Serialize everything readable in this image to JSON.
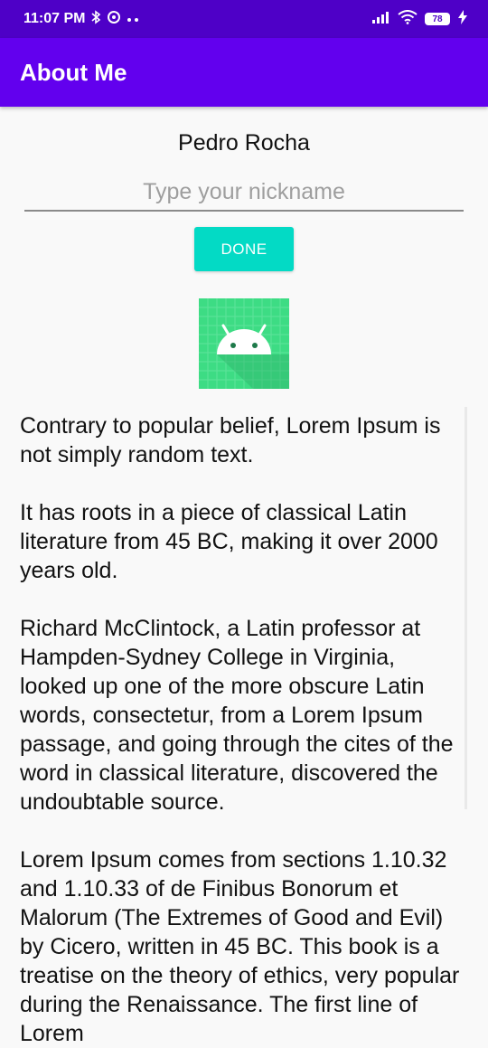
{
  "status_bar": {
    "time": "11:07 PM",
    "icons": [
      "bluetooth-icon",
      "hotspot-icon",
      "more-dots-icon",
      "signal-icon",
      "wifi-icon",
      "battery-icon",
      "charging-icon"
    ],
    "battery_level": "78"
  },
  "app_bar": {
    "title": "About Me"
  },
  "profile": {
    "name": "Pedro Rocha",
    "nickname_placeholder": "Type your nickname",
    "nickname_value": "",
    "done_label": "DONE"
  },
  "bio": {
    "text": "Contrary to popular belief, Lorem Ipsum is not simply random text.\n\nIt has roots in a piece of classical Latin literature from 45 BC, making it over 2000 years old.\n\nRichard McClintock, a Latin professor at Hampden-Sydney College in Virginia, looked up one of the more obscure Latin words, consectetur, from a Lorem Ipsum passage, and going through the cites of the word in classical literature, discovered the undoubtable source.\n\nLorem Ipsum comes from sections 1.10.32 and 1.10.33 of de Finibus Bonorum et Malorum (The Extremes of Good and Evil) by Cicero, written in 45 BC. This book is a treatise on the theory of ethics, very popular during the Renaissance. The first line of Lorem"
  },
  "colors": {
    "status_bar": "#4e00c7",
    "primary": "#6200ee",
    "accent": "#03dac5",
    "background": "#f9f9f9",
    "icon_green": "#3ddc84"
  }
}
